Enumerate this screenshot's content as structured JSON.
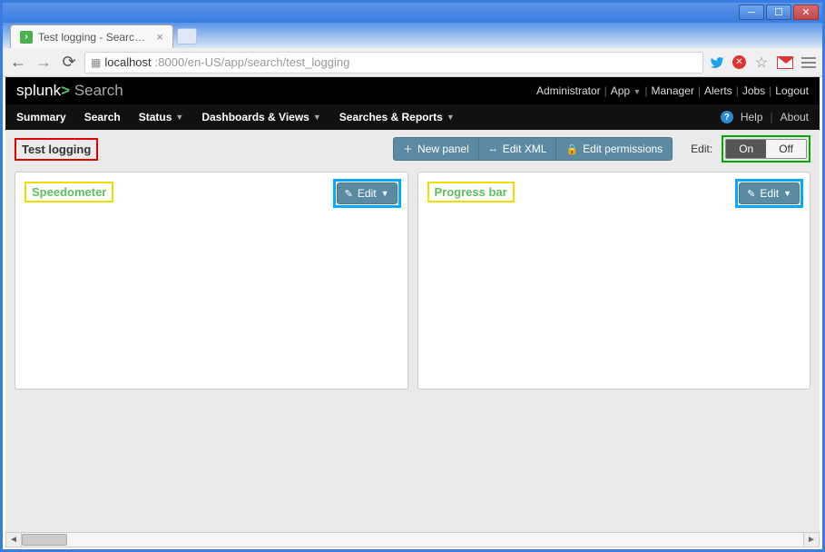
{
  "browser": {
    "tab_title": "Test logging - Search - Splun",
    "url_host": "localhost",
    "url_port_path": ":8000/en-US/app/search/test_logging"
  },
  "header": {
    "logo_brand": "splunk",
    "logo_gt": ">",
    "logo_app": "Search",
    "links": {
      "admin": "Administrator",
      "app": "App",
      "manager": "Manager",
      "alerts": "Alerts",
      "jobs": "Jobs",
      "logout": "Logout"
    }
  },
  "nav": {
    "summary": "Summary",
    "search": "Search",
    "status": "Status",
    "dashboards": "Dashboards & Views",
    "searches_reports": "Searches & Reports",
    "help": "Help",
    "about": "About"
  },
  "dashboard": {
    "title": "Test logging",
    "new_panel": "New panel",
    "edit_xml": "Edit XML",
    "edit_permissions": "Edit permissions",
    "edit_label": "Edit:",
    "toggle_on": "On",
    "toggle_off": "Off"
  },
  "panels": [
    {
      "title": "Speedometer",
      "edit_label": "Edit"
    },
    {
      "title": "Progress bar",
      "edit_label": "Edit"
    }
  ]
}
